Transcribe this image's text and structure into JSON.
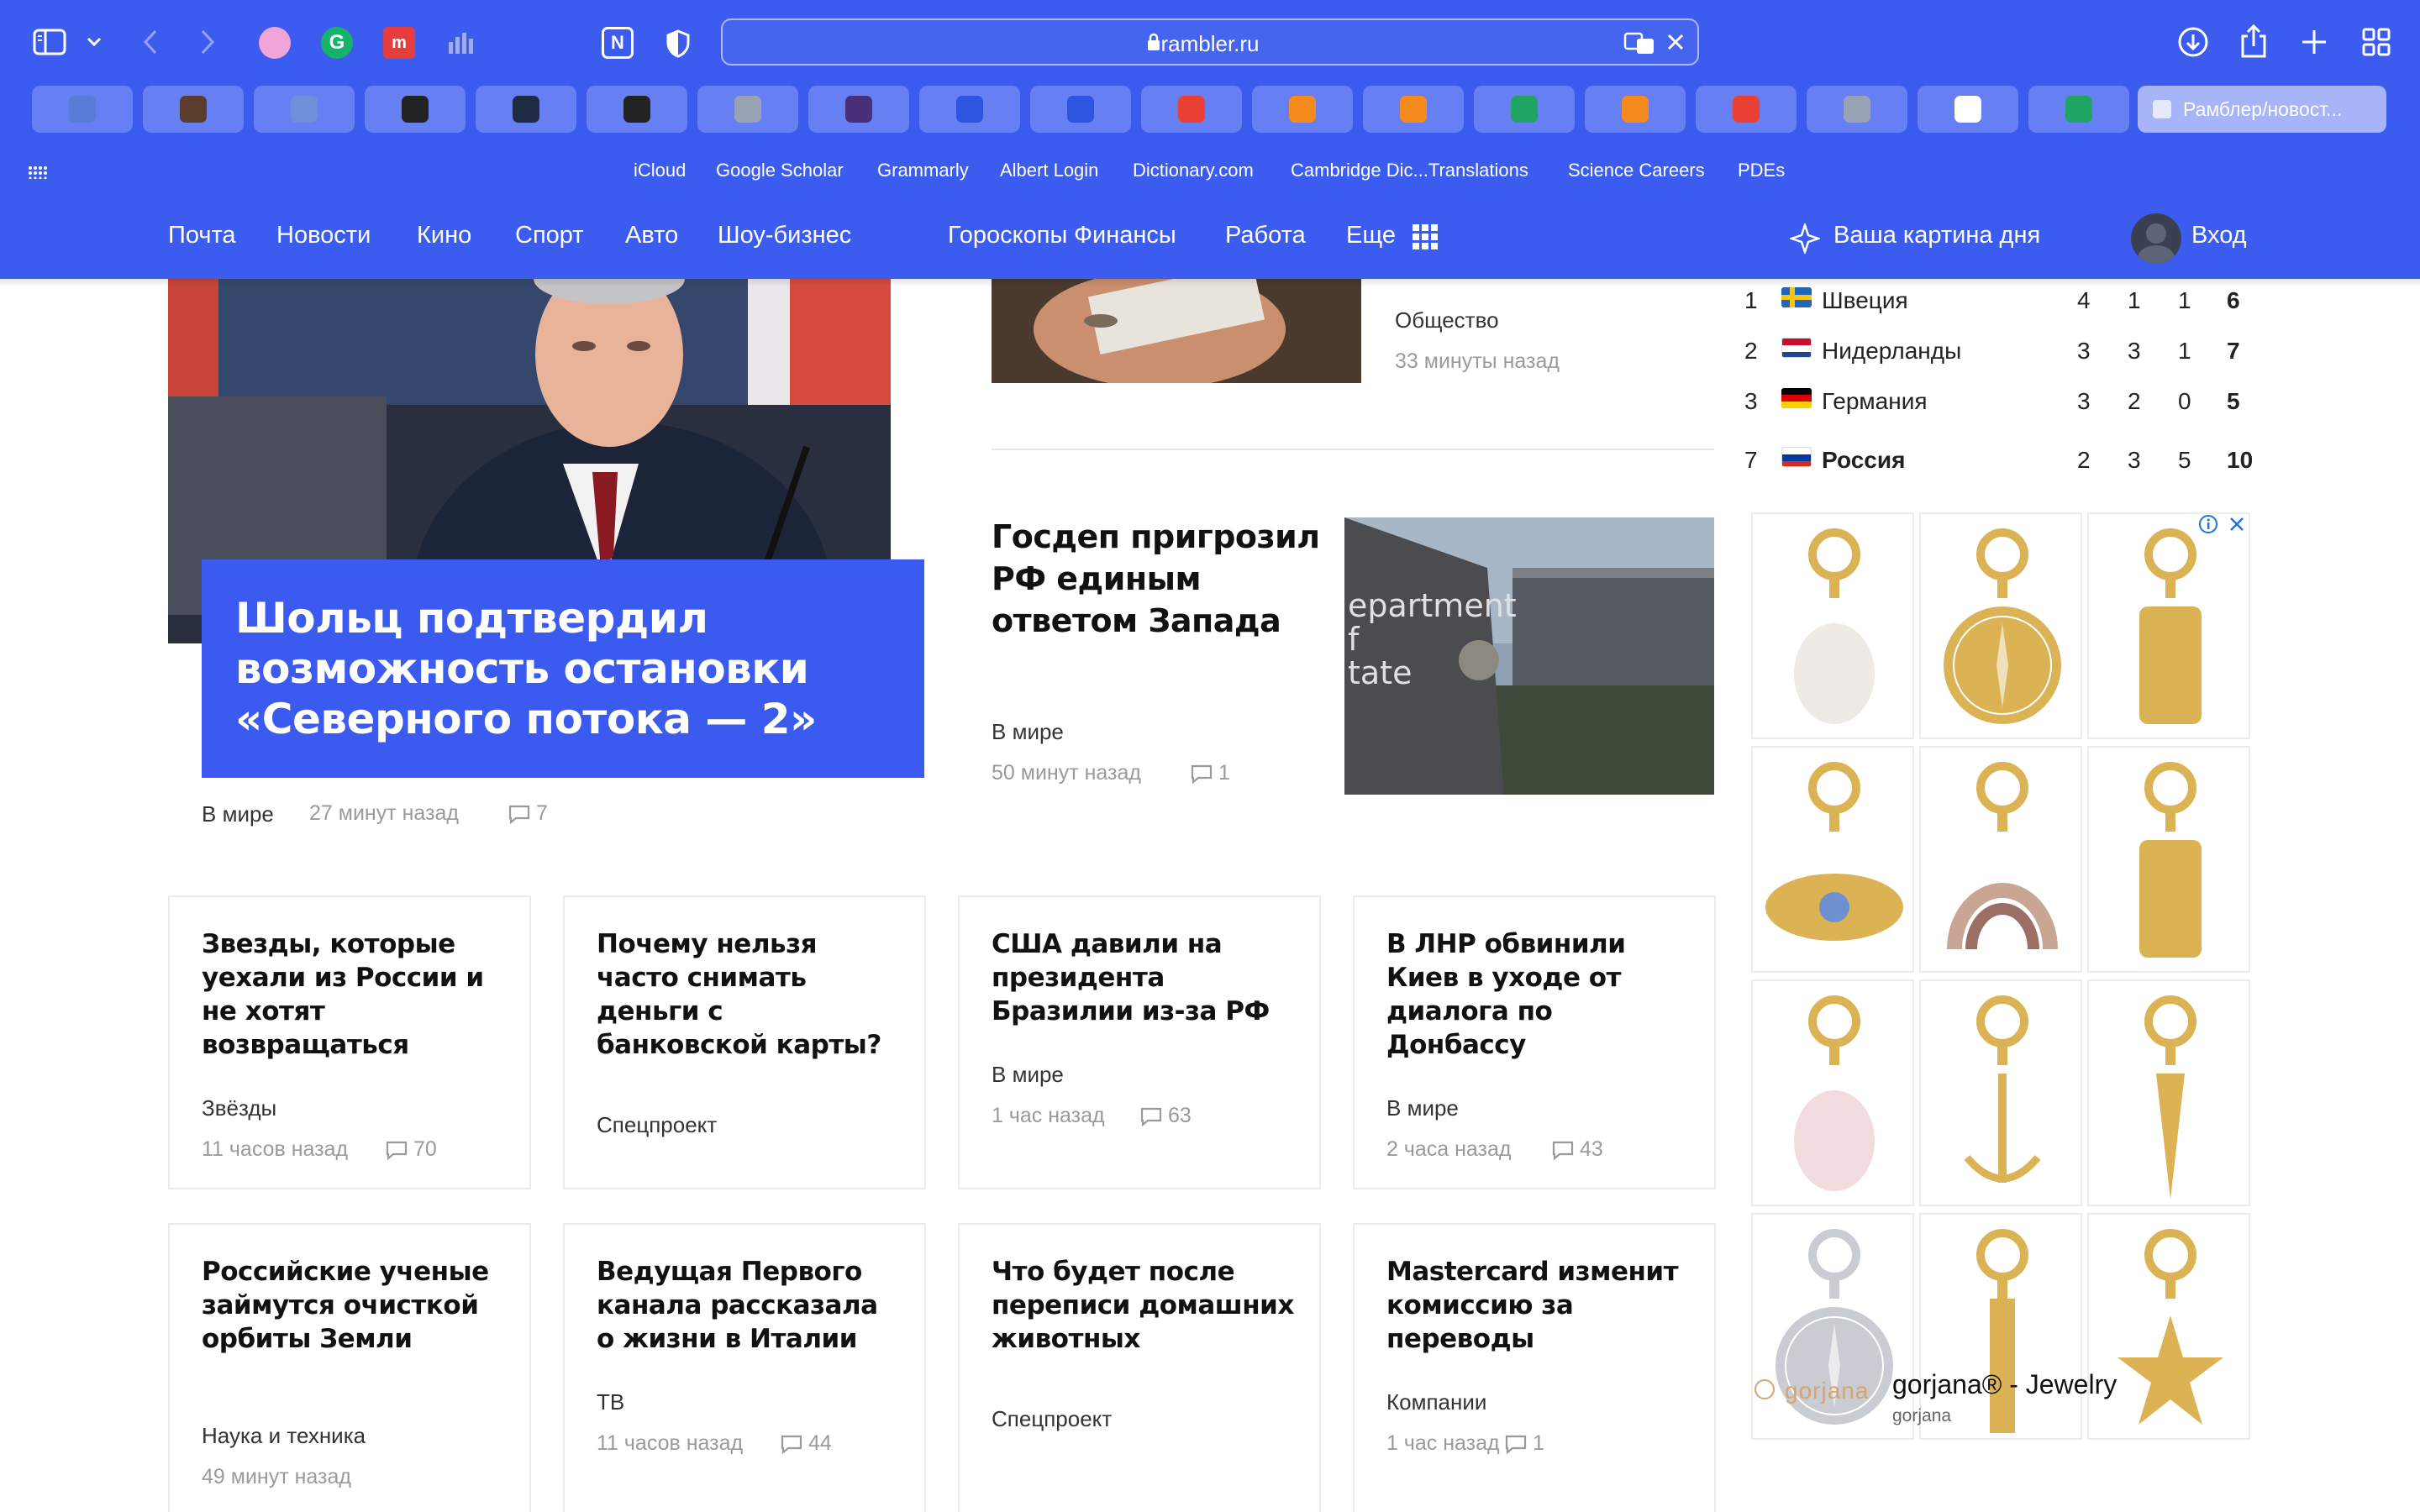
{
  "browser": {
    "url": "rambler.ru",
    "active_tab_label": "Рамблер/новост...",
    "tab_favicons": [
      {
        "icon": "layers-icon",
        "color": "#5a7bd6"
      },
      {
        "icon": "photo-icon",
        "color": "#5a3c2c"
      },
      {
        "icon": "r-icon",
        "color": "#6f8fd8"
      },
      {
        "icon": "loop-icon",
        "color": "#222222"
      },
      {
        "icon": "shield-book-icon",
        "color": "#1f2a44"
      },
      {
        "icon": "loop-icon",
        "color": "#222222"
      },
      {
        "icon": "q-icon",
        "color": "#9aa3b3"
      },
      {
        "icon": "monitor-icon",
        "color": "#4a2f7a"
      },
      {
        "icon": "q-blue-icon",
        "color": "#2d56e0"
      },
      {
        "icon": "q-blue-icon",
        "color": "#2d56e0"
      },
      {
        "icon": "gmail-icon",
        "color": "#e94235"
      },
      {
        "icon": "co-icon",
        "color": "#f58a1f"
      },
      {
        "icon": "co-icon",
        "color": "#f58a1f"
      },
      {
        "icon": "drive-icon",
        "color": "#1fa463"
      },
      {
        "icon": "co-icon",
        "color": "#f58a1f"
      },
      {
        "icon": "gmail-icon",
        "color": "#e94235"
      },
      {
        "icon": "m-icon",
        "color": "#9aa3b3"
      },
      {
        "icon": "doc-icon",
        "color": "#ffffff"
      },
      {
        "icon": "drive-icon",
        "color": "#1fa463"
      }
    ],
    "bookmarks": [
      "iCloud",
      "Google Scholar",
      "Grammarly",
      "Albert Login",
      "Dictionary.com",
      "Cambridge Dic...Translations",
      "Science Careers",
      "PDEs"
    ]
  },
  "nav": {
    "items": [
      "Почта",
      "Новости",
      "Кино",
      "Спорт",
      "Авто",
      "Шоу-бизнес",
      "Гороскопы",
      "Финансы",
      "Работа",
      "Еще"
    ],
    "picture_of_day": "Ваша картина дня",
    "login": "Вход"
  },
  "hero": {
    "title": "Шольц подтвердил возможность остановки «Северного потока — 2»",
    "category": "В мире",
    "time": "27 минут назад",
    "comments": "7"
  },
  "side_news": [
    {
      "category": "Общество",
      "time": "33 минуты назад"
    },
    {
      "title": "Госдеп пригрозил РФ единым ответом Запада",
      "category": "В мире",
      "time": "50 минут назад",
      "comments": "1"
    }
  ],
  "medals": [
    {
      "rank": "1",
      "country": "Швеция",
      "gold": "4",
      "silver": "1",
      "bronze": "1",
      "total": "6"
    },
    {
      "rank": "2",
      "country": "Нидерланды",
      "gold": "3",
      "silver": "3",
      "bronze": "1",
      "total": "7"
    },
    {
      "rank": "3",
      "country": "Германия",
      "gold": "3",
      "silver": "2",
      "bronze": "0",
      "total": "5"
    },
    {
      "rank": "7",
      "country": "Россия",
      "gold": "2",
      "silver": "3",
      "bronze": "5",
      "total": "10"
    }
  ],
  "cards_row1": [
    {
      "title": "Звезды, которые уехали из России и не хотят возвращаться",
      "category": "Звёзды",
      "time": "11 часов назад",
      "comments": "70"
    },
    {
      "title": "Почему нельзя часто снимать деньги с банковской карты?",
      "category": "Спецпроект"
    },
    {
      "title": "США давили на президента Бразилии из-за РФ",
      "category": "В мире",
      "time": "1 час назад",
      "comments": "63"
    },
    {
      "title": "В ЛНР обвинили Киев в уходе от диалога по Донбассу",
      "category": "В мире",
      "time": "2 часа назад",
      "comments": "43"
    }
  ],
  "cards_row2": [
    {
      "title": "Российские ученые займутся очисткой орбиты Земли",
      "category": "Наука и техника",
      "time": "49 минут назад"
    },
    {
      "title": "Ведущая Первого канала рассказала о жизни в Италии",
      "category": "ТВ",
      "time": "11 часов назад",
      "comments": "44"
    },
    {
      "title": "Что будет после переписи домашних животных",
      "category": "Спецпроект"
    },
    {
      "title": "Mastercard изменит комиссию за переводы",
      "category": "Компании",
      "time": "1 час назад",
      "comments": "1"
    }
  ],
  "ad": {
    "brand_logo": "gorjana",
    "title": "gorjana® - Jewelry",
    "subtitle": "gorjana"
  },
  "colors": {
    "brand": "#3c5cf0",
    "hero_box": "#3b5bf0"
  }
}
